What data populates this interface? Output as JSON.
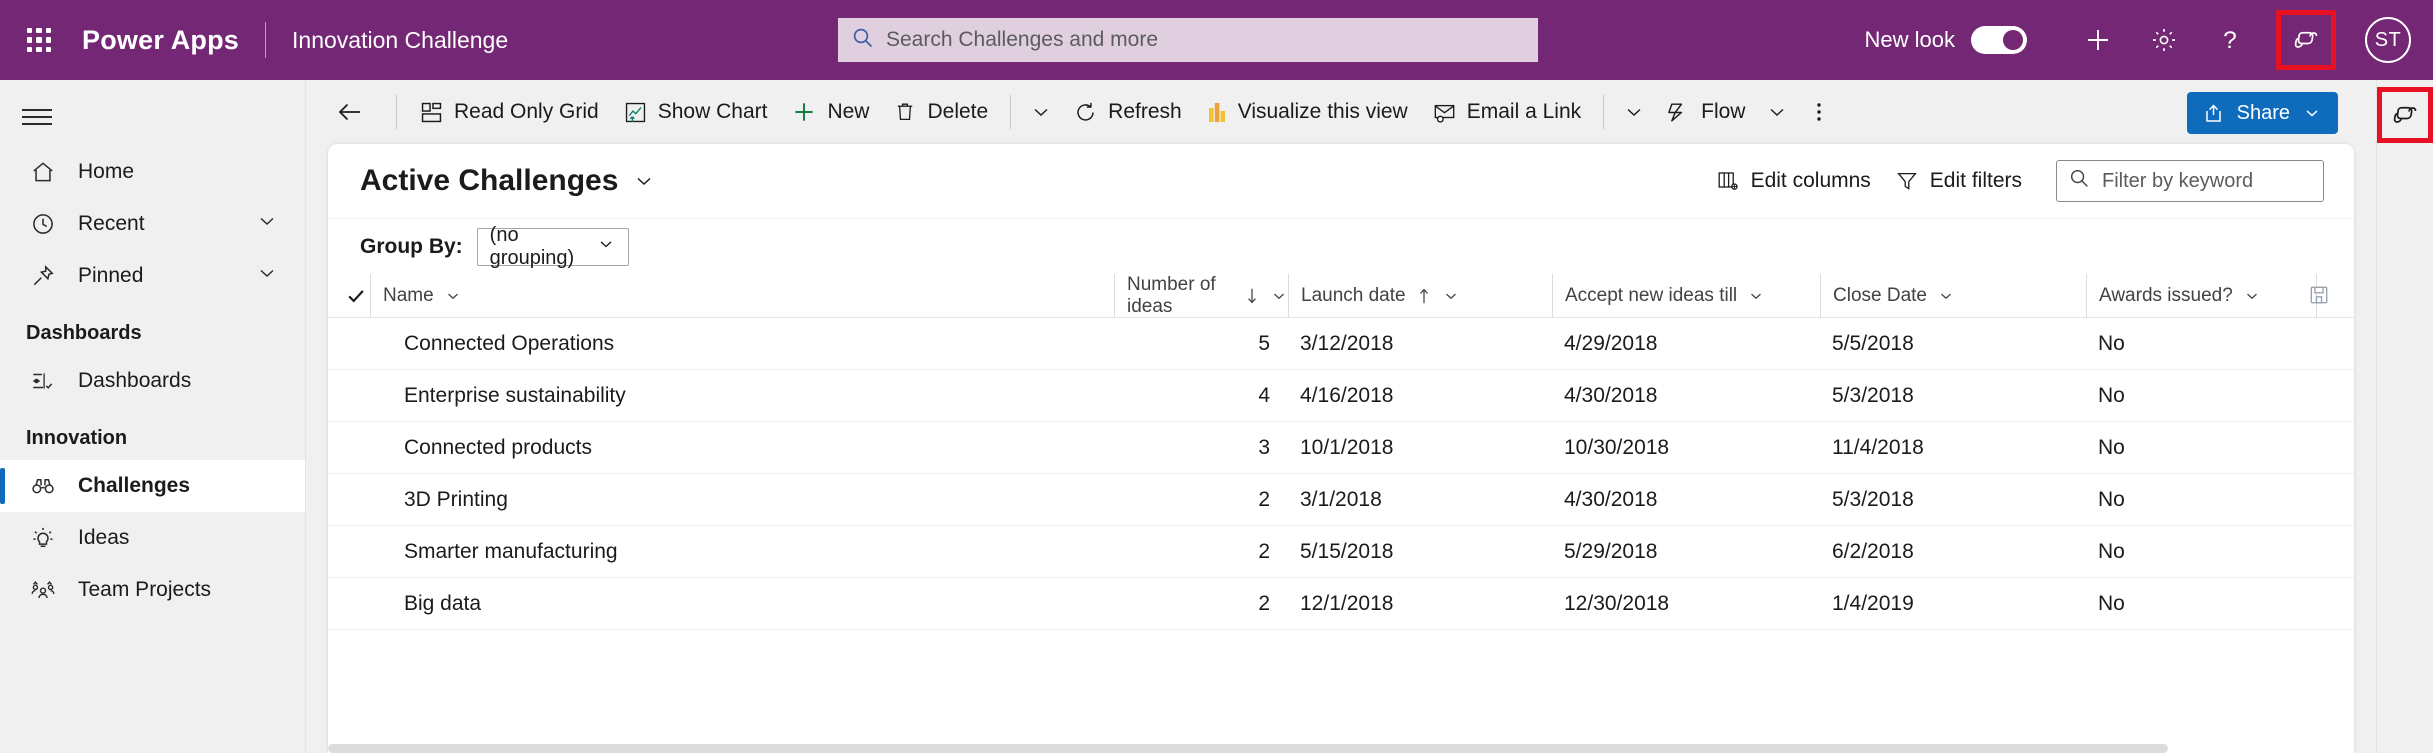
{
  "header": {
    "waffle_icon": "app-launcher-icon",
    "brand": "Power Apps",
    "app_name": "Innovation Challenge",
    "search_placeholder": "Search Challenges and more",
    "search_icon": "search-icon",
    "new_look_label": "New look",
    "new_look_on": true,
    "plus_icon": "plus-icon",
    "settings_icon": "gear-icon",
    "help_icon": "question-mark-icon",
    "copilot_icon": "copilot-icon",
    "avatar_initials": "ST",
    "bar_color": "#742774",
    "search_bg": "#dfcfdf",
    "highlight_color": "#e81123"
  },
  "sidebar": {
    "hamburger_icon": "hamburger-menu-icon",
    "items": [
      {
        "label": "Home",
        "icon": "home-icon",
        "chevron": false,
        "selected": false
      },
      {
        "label": "Recent",
        "icon": "clock-icon",
        "chevron": true,
        "selected": false
      },
      {
        "label": "Pinned",
        "icon": "pin-icon",
        "chevron": true,
        "selected": false
      }
    ],
    "sections": [
      {
        "title": "Dashboards",
        "items": [
          {
            "label": "Dashboards",
            "icon": "dashboard-icon",
            "selected": false
          }
        ]
      },
      {
        "title": "Innovation",
        "items": [
          {
            "label": "Challenges",
            "icon": "binoculars-icon",
            "selected": true
          },
          {
            "label": "Ideas",
            "icon": "lightbulb-icon",
            "selected": false
          },
          {
            "label": "Team Projects",
            "icon": "people-icon",
            "selected": false
          }
        ]
      }
    ],
    "selected_accent": "#0f6cbd"
  },
  "commandbar": {
    "back_icon": "back-arrow-icon",
    "buttons": [
      {
        "label": "Read Only Grid",
        "icon": "grid-icon"
      },
      {
        "label": "Show Chart",
        "icon": "chart-icon"
      },
      {
        "label": "New",
        "icon": "plus-icon"
      },
      {
        "label": "Delete",
        "icon": "trash-icon"
      }
    ],
    "overflow_chevron_1": "chevron-down-icon",
    "refresh": {
      "label": "Refresh",
      "icon": "refresh-icon"
    },
    "visualize": {
      "label": "Visualize this view",
      "icon": "powerbi-icon"
    },
    "email": {
      "label": "Email a Link",
      "icon": "email-icon"
    },
    "overflow_chevron_2": "chevron-down-icon",
    "flow": {
      "label": "Flow",
      "icon": "flow-icon"
    },
    "overflow_chevron_3": "chevron-down-icon",
    "more_icon": "ellipsis-vertical-icon",
    "share": {
      "label": "Share",
      "icon": "share-icon",
      "chevron": "chevron-down-icon",
      "color": "#0f6cbd"
    }
  },
  "rail": {
    "copilot_icon": "copilot-icon"
  },
  "view": {
    "title": "Active Challenges",
    "title_chevron": "chevron-down-icon",
    "edit_columns": {
      "label": "Edit columns",
      "icon": "edit-columns-icon"
    },
    "edit_filters": {
      "label": "Edit filters",
      "icon": "funnel-icon"
    },
    "filter_placeholder": "Filter by keyword",
    "filter_icon": "search-icon",
    "group_by_label": "Group By:",
    "group_by_value": "(no grouping)",
    "group_by_chevron": "chevron-down-icon",
    "save_icon": "save-icon"
  },
  "grid": {
    "select_all_icon": "checkmark-icon",
    "columns": [
      {
        "key": "name",
        "label": "Name",
        "sort": null,
        "chevron": "chevron-down-icon"
      },
      {
        "key": "ideas",
        "label": "Number of ideas",
        "sort": "desc",
        "chevron": "chevron-down-icon"
      },
      {
        "key": "launch",
        "label": "Launch date",
        "sort": "asc",
        "chevron": "chevron-down-icon"
      },
      {
        "key": "accept",
        "label": "Accept new ideas till",
        "sort": null,
        "chevron": "chevron-down-icon"
      },
      {
        "key": "close",
        "label": "Close Date",
        "sort": null,
        "chevron": "chevron-down-icon"
      },
      {
        "key": "awards",
        "label": "Awards issued?",
        "sort": null,
        "chevron": "chevron-down-icon"
      }
    ],
    "rows": [
      {
        "name": "Connected Operations",
        "ideas": "5",
        "launch": "3/12/2018",
        "accept": "4/29/2018",
        "close": "5/5/2018",
        "awards": "No"
      },
      {
        "name": "Enterprise sustainability",
        "ideas": "4",
        "launch": "4/16/2018",
        "accept": "4/30/2018",
        "close": "5/3/2018",
        "awards": "No"
      },
      {
        "name": "Connected products",
        "ideas": "3",
        "launch": "10/1/2018",
        "accept": "10/30/2018",
        "close": "11/4/2018",
        "awards": "No"
      },
      {
        "name": "3D Printing",
        "ideas": "2",
        "launch": "3/1/2018",
        "accept": "4/30/2018",
        "close": "5/3/2018",
        "awards": "No"
      },
      {
        "name": "Smarter manufacturing",
        "ideas": "2",
        "launch": "5/15/2018",
        "accept": "5/29/2018",
        "close": "6/2/2018",
        "awards": "No"
      },
      {
        "name": "Big data",
        "ideas": "2",
        "launch": "12/1/2018",
        "accept": "12/30/2018",
        "close": "1/4/2019",
        "awards": "No"
      }
    ]
  }
}
